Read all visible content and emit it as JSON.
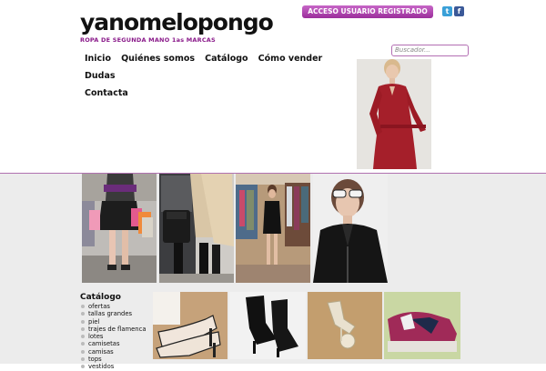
{
  "brand": {
    "name": "yanomelopongo",
    "tagline": "ROPA DE SEGUNDA MANO 1as MARCAS"
  },
  "header": {
    "login_label": "ACCESO USUARIO REGISTRADO",
    "twitter_glyph": "t",
    "facebook_glyph": "f"
  },
  "nav": {
    "items": [
      {
        "label": "Inicio"
      },
      {
        "label": "Quiénes somos"
      },
      {
        "label": "Catálogo"
      },
      {
        "label": "Cómo vender"
      },
      {
        "label": "Dudas"
      },
      {
        "label": "Contacta"
      }
    ]
  },
  "search": {
    "placeholder": "Buscador..."
  },
  "catalog": {
    "title": "Catálogo",
    "items": [
      {
        "label": "ofertas"
      },
      {
        "label": "tallas grandes"
      },
      {
        "label": "piel"
      },
      {
        "label": "trajes de flamenca"
      },
      {
        "label": "lotes"
      },
      {
        "label": "camisetas"
      },
      {
        "label": "camisas"
      },
      {
        "label": "tops"
      },
      {
        "label": "vestidos"
      }
    ]
  },
  "colors": {
    "accent": "#9b2e9b",
    "divider": "#b071b0",
    "background": "#ececec"
  },
  "icons": {
    "twitter": "twitter-icon",
    "facebook": "facebook-icon"
  }
}
